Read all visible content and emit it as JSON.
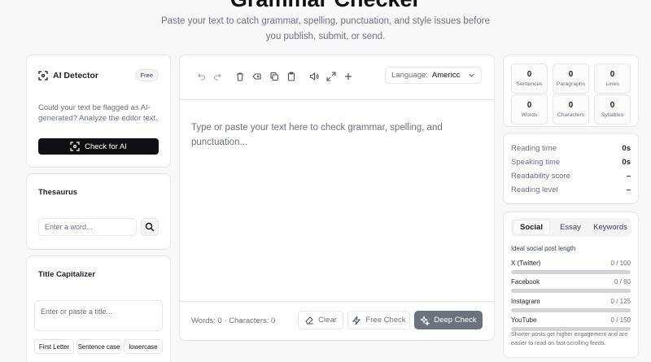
{
  "header": {
    "title": "Grammar Checker",
    "subtitle": "Paste your text to catch grammar, spelling, punctuation, and style issues before you publish, submit, or send."
  },
  "ai_detector": {
    "title": "AI Detector",
    "badge": "Free",
    "description": "Could your text be flagged as AI-generated? Analyze the editor text.",
    "button": "Check for AI"
  },
  "thesaurus": {
    "title": "Thesaurus",
    "placeholder": "Enter a word..."
  },
  "title_capitalizer": {
    "title": "Title Capitalizer",
    "placeholder": "Enter or paste a title...",
    "options": [
      "First Letter",
      "Sentence case",
      "lowercase"
    ]
  },
  "editor": {
    "language_label": "Language:",
    "language_value": "Americc",
    "placeholder": "Type or paste your text here to check grammar, spelling, and punctuation...",
    "footer_counts": "Words: 0 · Characters: 0",
    "clear": "Clear",
    "free_check": "Free Check",
    "deep_check": "Deep Check"
  },
  "stats": [
    {
      "value": "0",
      "label": "Sentences"
    },
    {
      "value": "0",
      "label": "Paragraphs"
    },
    {
      "value": "0",
      "label": "Lines"
    },
    {
      "value": "0",
      "label": "Words"
    },
    {
      "value": "0",
      "label": "Characters"
    },
    {
      "value": "0",
      "label": "Syllables"
    }
  ],
  "metrics": [
    {
      "label": "Reading time",
      "value": "0s"
    },
    {
      "label": "Speaking time",
      "value": "0s"
    },
    {
      "label": "Readability score",
      "value": "–"
    },
    {
      "label": "Reading level",
      "value": "–"
    }
  ],
  "social": {
    "tabs": [
      "Social",
      "Essay",
      "Keywords"
    ],
    "active_tab": "Social",
    "heading": "Ideal social post length",
    "platforms": [
      {
        "name": "X (Twitter)",
        "count": "0 / 100",
        "fill": 0
      },
      {
        "name": "Facebook",
        "count": "0 / 80",
        "fill": 0
      },
      {
        "name": "Instagram",
        "count": "0 / 125",
        "fill": 0
      },
      {
        "name": "YouTube",
        "count": "0 / 150",
        "fill": 0
      }
    ],
    "note": "Shorter posts get higher engagement and are easier to read on fast-scrolling feeds."
  }
}
